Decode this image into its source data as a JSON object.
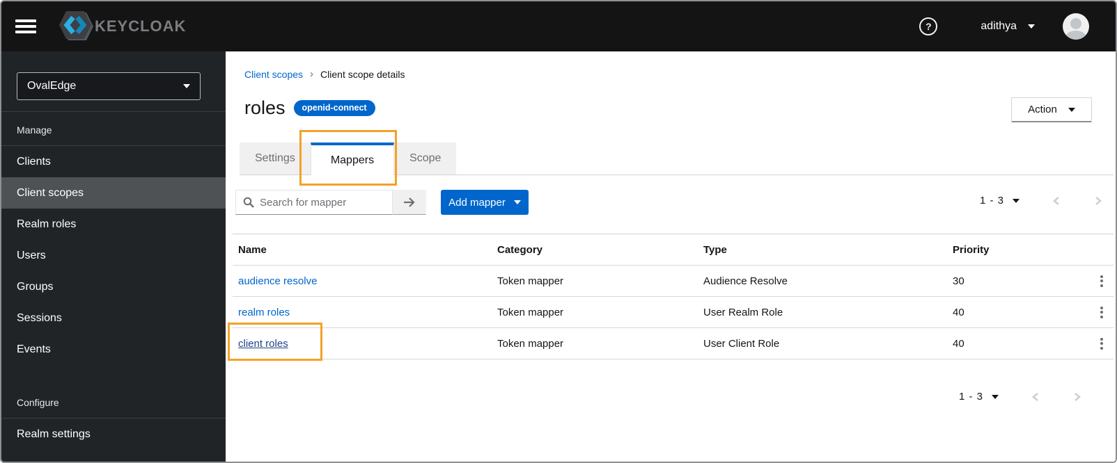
{
  "header": {
    "brand": "KEYCLOAK",
    "help_glyph": "?",
    "user": "adithya"
  },
  "sidebar": {
    "realm": "OvalEdge",
    "manage_label": "Manage",
    "manage_items": [
      "Clients",
      "Client scopes",
      "Realm roles",
      "Users",
      "Groups",
      "Sessions",
      "Events"
    ],
    "selected_item": "Client scopes",
    "configure_label": "Configure",
    "configure_items": [
      "Realm settings"
    ]
  },
  "breadcrumb": {
    "parent": "Client scopes",
    "separator": "›",
    "current": "Client scope details"
  },
  "page": {
    "title": "roles",
    "protocol_badge": "openid-connect",
    "action_label": "Action"
  },
  "tabs": [
    {
      "label": "Settings",
      "active": false
    },
    {
      "label": "Mappers",
      "active": true
    },
    {
      "label": "Scope",
      "active": false
    }
  ],
  "toolbar": {
    "search_placeholder": "Search for mapper",
    "add_mapper_label": "Add mapper"
  },
  "pagination": {
    "top_range": "1 - 3",
    "bottom_range": "1 - 3"
  },
  "table": {
    "columns": [
      "Name",
      "Category",
      "Type",
      "Priority"
    ],
    "rows": [
      {
        "name": "audience resolve",
        "category": "Token mapper",
        "type": "Audience Resolve",
        "priority": "30"
      },
      {
        "name": "realm roles",
        "category": "Token mapper",
        "type": "User Realm Role",
        "priority": "40"
      },
      {
        "name": "client roles",
        "category": "Token mapper",
        "type": "User Client Role",
        "priority": "40"
      }
    ]
  },
  "annotations": {
    "highlight_color": "#F2A229",
    "highlighted_targets": [
      "Mappers tab",
      "client roles link"
    ]
  },
  "colors": {
    "primary_blue": "#0066CC",
    "masthead_bg": "#141414",
    "sidebar_bg": "#212427",
    "sidebar_selected_bg": "#4F5255",
    "link_blue": "#0066CC",
    "link_hover_blue": "#1F4387",
    "inactive_tab_bg": "#F0F0F0",
    "muted_text": "#6A6E73"
  }
}
